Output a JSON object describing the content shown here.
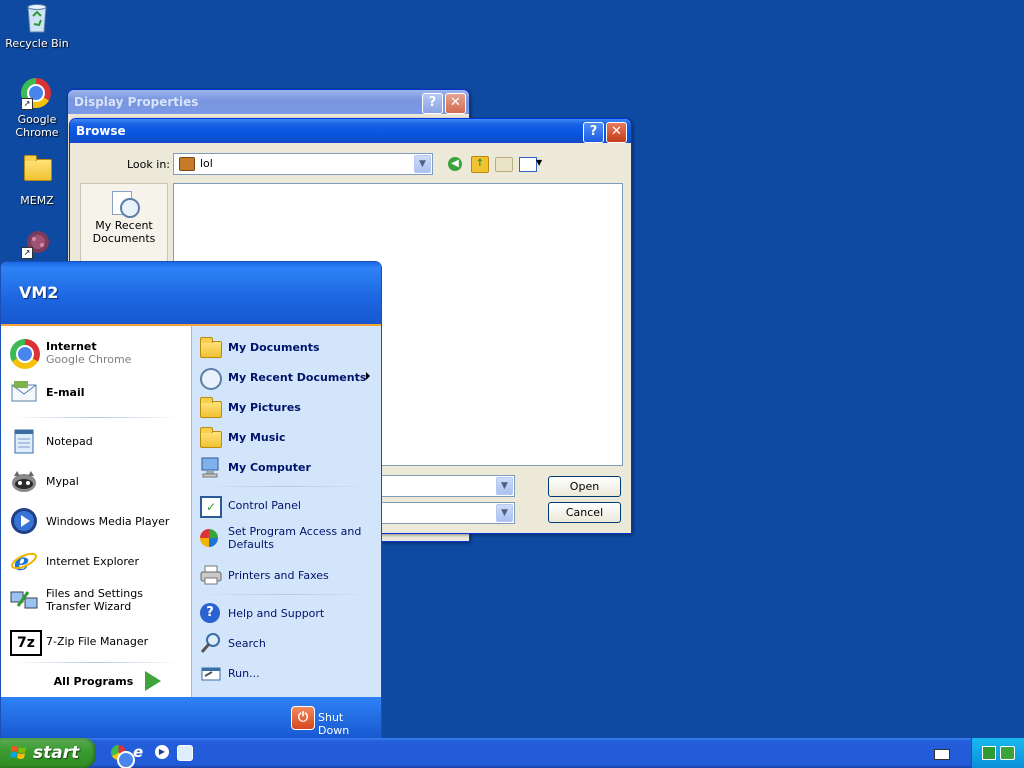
{
  "desktop": {
    "icons": [
      {
        "label": "Recycle Bin",
        "icon": "recycle-bin-icon"
      },
      {
        "label": "Google Chrome",
        "icon": "chrome-icon"
      },
      {
        "label": "MEMZ",
        "icon": "folder-icon"
      },
      {
        "label": "",
        "icon": "virus-shortcut-icon"
      }
    ]
  },
  "display_properties": {
    "title": "Display Properties"
  },
  "browse_dialog": {
    "title": "Browse",
    "look_in_label": "Look in:",
    "look_in_value": "lol",
    "places": [
      {
        "label": "My Recent Documents"
      }
    ],
    "open_label": "Open",
    "cancel_label": "Cancel"
  },
  "start_menu": {
    "user": "VM2",
    "pinned": [
      {
        "title": "Internet",
        "subtitle": "Google Chrome",
        "icon": "chrome-icon"
      },
      {
        "title": "E-mail",
        "subtitle": "",
        "icon": "email-icon"
      }
    ],
    "recent": [
      {
        "label": "Notepad",
        "icon": "notepad-icon"
      },
      {
        "label": "Mypal",
        "icon": "mypal-icon"
      },
      {
        "label": "Windows Media Player",
        "icon": "media-player-icon"
      },
      {
        "label": "Internet Explorer",
        "icon": "ie-icon"
      },
      {
        "label": "Files and Settings Transfer Wizard",
        "icon": "transfer-wizard-icon"
      },
      {
        "label": "7-Zip File Manager",
        "icon": "7zip-icon"
      }
    ],
    "all_programs": "All Programs",
    "right": [
      {
        "label": "My Documents",
        "bold": true,
        "icon": "my-documents-icon"
      },
      {
        "label": "My Recent Documents",
        "bold": true,
        "icon": "recent-documents-icon"
      },
      {
        "label": "My Pictures",
        "bold": true,
        "icon": "my-pictures-icon"
      },
      {
        "label": "My Music",
        "bold": true,
        "icon": "my-music-icon"
      },
      {
        "label": "My Computer",
        "bold": true,
        "icon": "my-computer-icon"
      },
      {
        "label": "Control Panel",
        "bold": false,
        "icon": "control-panel-icon"
      },
      {
        "label": "Set Program Access and Defaults",
        "bold": false,
        "icon": "program-access-icon"
      },
      {
        "label": "Printers and Faxes",
        "bold": false,
        "icon": "printer-icon"
      },
      {
        "label": "Help and Support",
        "bold": false,
        "icon": "help-icon"
      },
      {
        "label": "Search",
        "bold": false,
        "icon": "search-icon"
      },
      {
        "label": "Run...",
        "bold": false,
        "icon": "run-icon"
      }
    ],
    "shutdown": "Shut Down"
  },
  "taskbar": {
    "start_label": "start",
    "quick_launch": [
      "chrome-icon",
      "ie-icon",
      "media-player-icon",
      "mypal-icon"
    ]
  },
  "colors": {
    "desktop": "#0e4aa1",
    "title_active": "#0a58e6",
    "start_green": "#3c9c31",
    "menu_right": "#d3e5fa"
  }
}
